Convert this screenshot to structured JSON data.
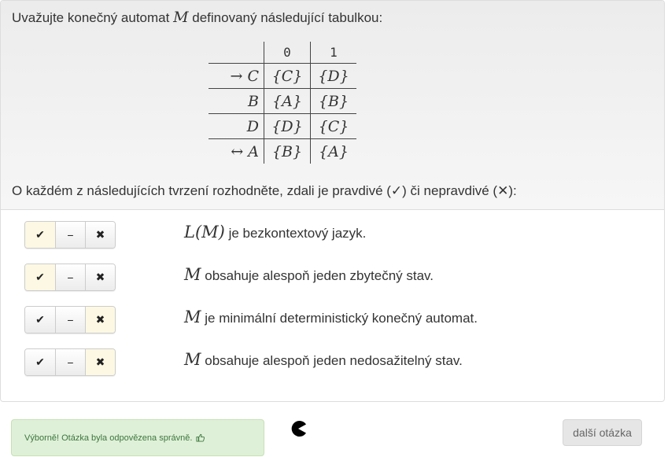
{
  "intro": {
    "before": "Uvažujte konečný automat ",
    "symbol": "M",
    "after": " definovaný následující tabulkou:"
  },
  "table": {
    "header": [
      "",
      "0",
      "1"
    ],
    "rows": [
      {
        "state": "→ C",
        "t0": "{C}",
        "t1": "{D}"
      },
      {
        "state": "B",
        "t0": "{A}",
        "t1": "{B}"
      },
      {
        "state": "D",
        "t0": "{D}",
        "t1": "{C}"
      },
      {
        "state": "↔ A",
        "t0": "{B}",
        "t1": "{A}"
      }
    ]
  },
  "question": "O každém z následujících tvrzení rozhodněte, zdali je pravdivé (✓) či nepravdivé (✕):",
  "buttons": {
    "true": "✔",
    "neutral": "−",
    "false": "✖"
  },
  "statements": [
    {
      "math": "L(M)",
      "text": " je bezkontextový jazyk.",
      "selected": "true"
    },
    {
      "math": "M",
      "text": " obsahuje alespoň jeden zbytečný stav.",
      "selected": "true"
    },
    {
      "math": "M",
      "text": " je minimální deterministický konečný automat.",
      "selected": "false"
    },
    {
      "math": "M",
      "text": " obsahuje alespoň jeden nedosažitelný stav.",
      "selected": "false"
    }
  ],
  "feedback": "Výborně! Otázka byla odpovězena správně.",
  "feedback_icon": "thumbs-up-icon",
  "next_button": "další otázka",
  "colors": {
    "selected": "#fcf8e3",
    "success_bg": "#dff0d8",
    "success_text": "#3c763d"
  }
}
